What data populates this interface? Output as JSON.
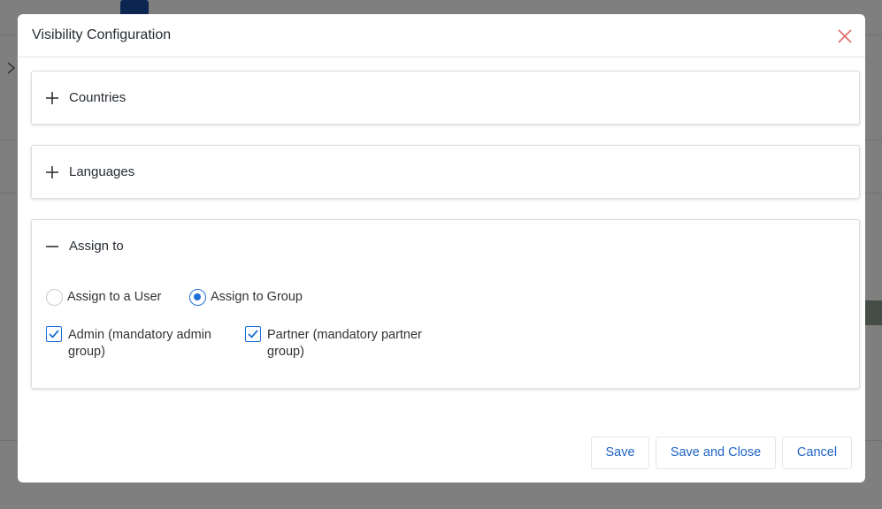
{
  "modal": {
    "title": "Visibility Configuration",
    "close_icon": "close-icon"
  },
  "panels": {
    "countries": {
      "label": "Countries",
      "state": "collapsed",
      "icon": "plus-icon"
    },
    "languages": {
      "label": "Languages",
      "state": "collapsed",
      "icon": "plus-icon"
    },
    "assign": {
      "label": "Assign to",
      "state": "expanded",
      "icon": "minus-icon",
      "radios": [
        {
          "label": "Assign to a User",
          "selected": false
        },
        {
          "label": "Assign to Group",
          "selected": true
        }
      ],
      "groups": [
        {
          "label": "Admin (mandatory admin group)",
          "checked": true
        },
        {
          "label": "Partner (mandatory partner group)",
          "checked": true
        }
      ]
    }
  },
  "buttons": {
    "save": "Save",
    "save_and_close": "Save and Close",
    "cancel": "Cancel"
  },
  "colors": {
    "accent": "#1d6fd6",
    "close_icon": "#e06b6b",
    "overlay": "rgba(0,0,0,0.5)"
  }
}
